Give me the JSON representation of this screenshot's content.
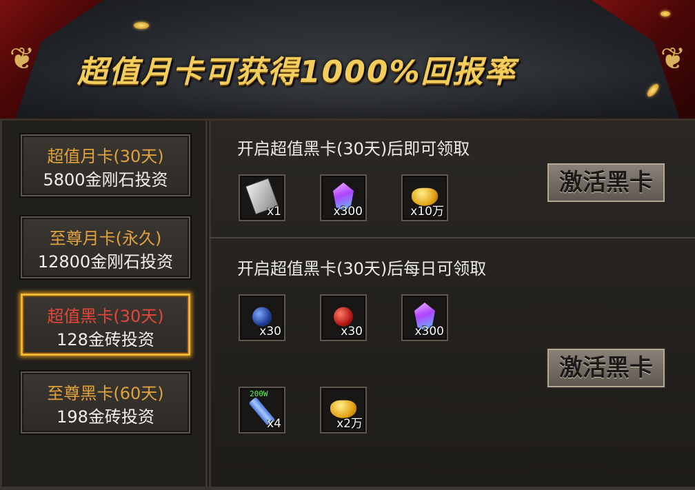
{
  "banner": {
    "title": "超值月卡可获得1000%回报率"
  },
  "cards": [
    {
      "line1": "超值月卡(30天)",
      "line2": "5800金刚石投资",
      "selected": false
    },
    {
      "line1": "至尊月卡(永久)",
      "line2": "12800金刚石投资",
      "selected": false
    },
    {
      "line1": "超值黑卡(30天)",
      "line2": "128金砖投资",
      "selected": true
    },
    {
      "line1": "至尊黑卡(60天)",
      "line2": "198金砖投资",
      "selected": false
    }
  ],
  "section_once": {
    "title": "开启超值黑卡(30天)后即可领取",
    "items": [
      {
        "icon": "black-card-icon",
        "qty": "x1"
      },
      {
        "icon": "purple-gem-icon",
        "qty": "x300"
      },
      {
        "icon": "gold-ingot-icon",
        "qty": "x10万"
      }
    ],
    "button": "激活黑卡"
  },
  "section_daily": {
    "title": "开启超值黑卡(30天)后每日可领取",
    "items": [
      {
        "icon": "blue-orb-icon",
        "qty": "x30"
      },
      {
        "icon": "red-orb-icon",
        "qty": "x30"
      },
      {
        "icon": "purple-gem-icon",
        "qty": "x300"
      },
      {
        "icon": "exp-scroll-icon",
        "qty": "x4",
        "tag": "200W"
      },
      {
        "icon": "gold-ingot-icon",
        "qty": "x2万"
      }
    ],
    "button": "激活黑卡"
  },
  "colors": {
    "card_title": "#e0a23c",
    "card_selected_title": "#e2473a",
    "selected_border": "#f0b733",
    "banner_title": "#f2cd5b"
  }
}
